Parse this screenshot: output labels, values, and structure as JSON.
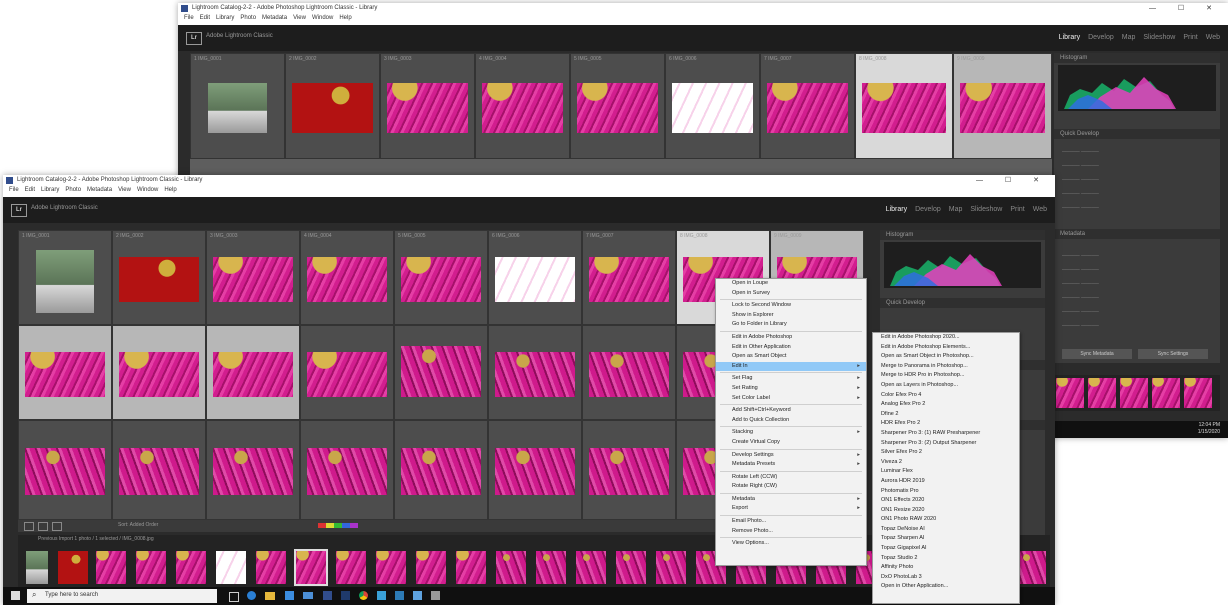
{
  "window": {
    "title": "Lightroom Catalog-2-2 - Adobe Photoshop Lightroom Classic - Library",
    "menu": [
      "File",
      "Edit",
      "Library",
      "Photo",
      "Metadata",
      "View",
      "Window",
      "Help"
    ],
    "app_name": "Adobe Lightroom Classic",
    "controls": "— ☐ ✕"
  },
  "modules": [
    "Library",
    "Develop",
    "Map",
    "Slideshow",
    "Print",
    "Web"
  ],
  "grid_headers": [
    "1  IMG_0001",
    "2  IMG_0002",
    "3  IMG_0003",
    "4  IMG_0004",
    "5  IMG_0005",
    "6  IMG_0006",
    "7  IMG_0007",
    "8  IMG_0008",
    "9  IMG_0009"
  ],
  "right_panel": {
    "histogram_title": "Histogram",
    "quick_develop": "Quick Develop",
    "keywording": "Keywording",
    "metadata": "Metadata",
    "sync": "Sync Metadata",
    "sync_settings": "Sync Settings"
  },
  "filmstrip_label": "Previous Import   1 photo / 1 selected / IMG_0008.jpg",
  "toolbar_label": "Sort: Added Order",
  "taskbar": {
    "search": "Type here to search",
    "time": "12:04 PM",
    "date": "1/15/2020"
  },
  "context_menu": {
    "items": [
      "Open in Loupe",
      "Open in Survey",
      "—",
      "Lock to Second Window",
      "Show in Explorer",
      "Go to Folder in Library",
      "—",
      "Edit in Adobe Photoshop",
      "Edit in Other Application",
      "Open as Smart Object",
      "Edit In",
      "—",
      "Set Flag",
      "Set Rating",
      "Set Color Label",
      "—",
      "Add Shift+Ctrl+Keyword",
      "Add to Quick Collection",
      "—",
      "Stacking",
      "Create Virtual Copy",
      "—",
      "Develop Settings",
      "Metadata Presets",
      "—",
      "Rotate Left (CCW)",
      "Rotate Right (CW)",
      "—",
      "Metadata",
      "Export",
      "—",
      "Email Photo...",
      "Remove Photo...",
      "—",
      "View Options..."
    ],
    "highlight_index": 10,
    "shortcut": "Ctrl+E"
  },
  "submenu": {
    "items": [
      "Edit in Adobe Photoshop 2020...",
      "Edit in Adobe Photoshop Elements...",
      "Open as Smart Object in Photoshop...",
      "Merge to Panorama in Photoshop...",
      "Merge to HDR Pro in Photoshop...",
      "Open as Layers in Photoshop...",
      "Color Efex Pro 4",
      "Analog Efex Pro 2",
      "Dfine 2",
      "HDR Efex Pro 2",
      "Sharpener Pro 3: (1) RAW Presharpener",
      "Sharpener Pro 3: (2) Output Sharpener",
      "Silver Efex Pro 2",
      "Viveza 2",
      "Luminar Flex",
      "Aurora HDR 2019",
      "Photomatix Pro",
      "ON1 Effects 2020",
      "ON1 Resize 2020",
      "ON1 Photo RAW 2020",
      "Topaz DeNoise AI",
      "Topaz Sharpen AI",
      "Topaz Gigapixel AI",
      "Topaz Studio 2",
      "Affinity Photo",
      "DxO PhotoLab 3",
      "Open in Other Application..."
    ]
  }
}
